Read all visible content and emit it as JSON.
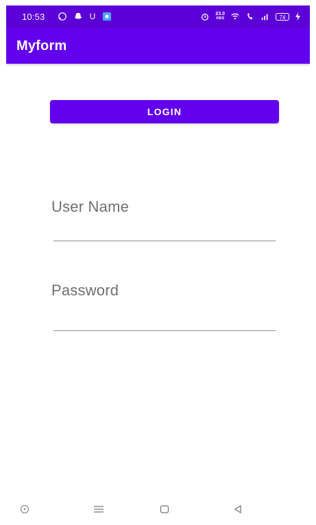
{
  "status_bar": {
    "time": "10:53",
    "speed_value": "23.0",
    "speed_unit": "KB/S",
    "battery": "74",
    "icons": [
      "whatsapp-icon",
      "snapchat-icon",
      "u-icon",
      "app-icon",
      "alarm-icon",
      "wifi-icon",
      "call-icon",
      "signal-icon",
      "battery-icon",
      "charging-icon"
    ]
  },
  "app_bar": {
    "title": "Myform"
  },
  "login": {
    "label": "LOGIN"
  },
  "fields": {
    "username_label": "User Name",
    "password_label": "Password"
  },
  "nav": {
    "items": [
      "settings-circle-icon",
      "menu-icon",
      "home-square-icon",
      "back-triangle-icon"
    ]
  },
  "colors": {
    "primary": "#6200ee",
    "status_bar": "#5b00d7",
    "text_muted": "#6f6f6f",
    "divider": "#8d8d8d"
  }
}
